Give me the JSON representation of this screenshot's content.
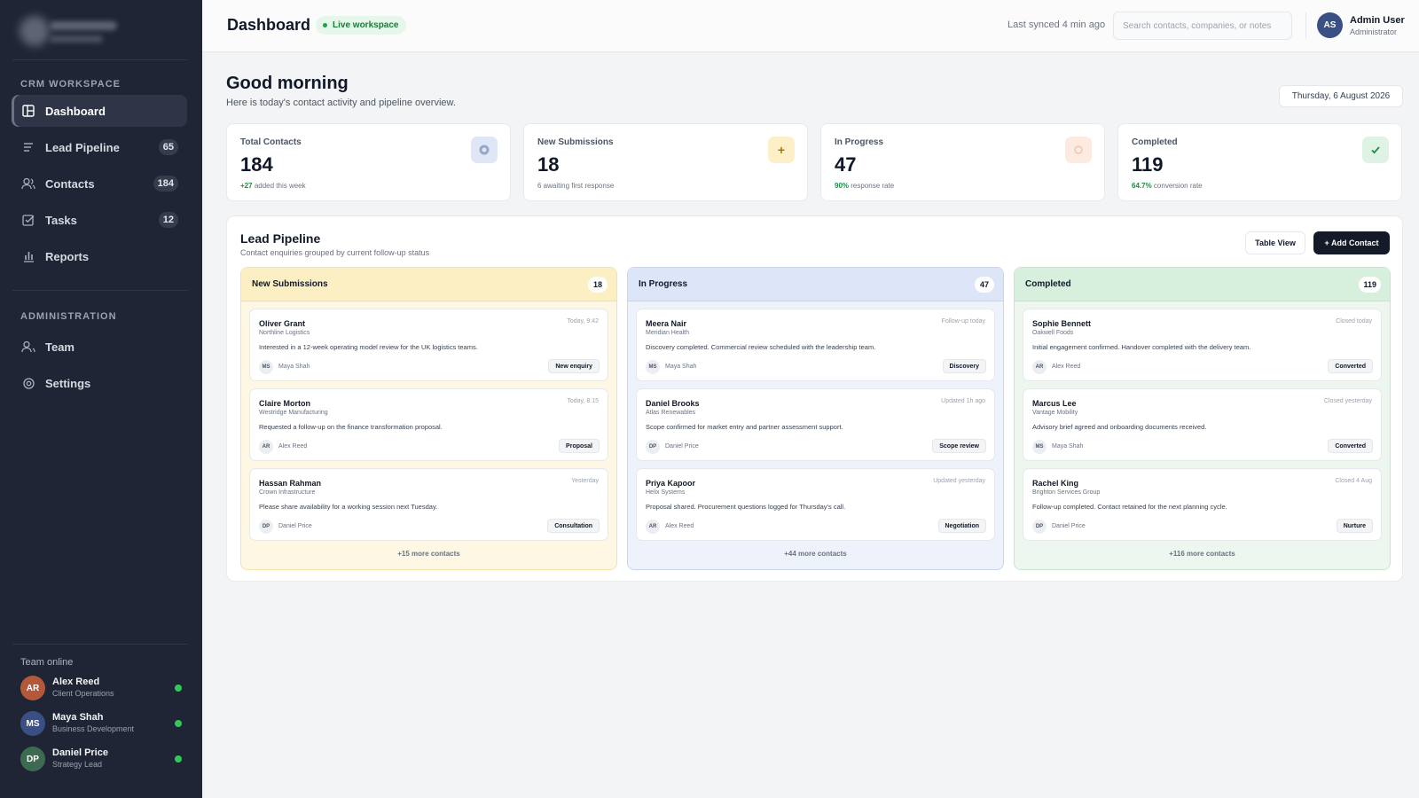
{
  "sidebar": {
    "sections": {
      "workspace": "CRM WORKSPACE",
      "admin": "ADMINISTRATION"
    },
    "nav": [
      {
        "label": "Dashboard",
        "icon": "dashboard-icon",
        "active": true
      },
      {
        "label": "Lead Pipeline",
        "icon": "pipeline-icon",
        "badge": "65"
      },
      {
        "label": "Contacts",
        "icon": "contacts-icon",
        "badge": "184"
      },
      {
        "label": "Tasks",
        "icon": "tasks-icon",
        "badge": "12"
      },
      {
        "label": "Reports",
        "icon": "reports-icon"
      }
    ],
    "admin_nav": [
      {
        "label": "Team",
        "icon": "team-icon"
      },
      {
        "label": "Settings",
        "icon": "settings-icon"
      }
    ],
    "team_title": "Team online",
    "team": [
      {
        "initials": "AR",
        "name": "Alex Reed",
        "role": "Client Operations",
        "color": "#b4583a"
      },
      {
        "initials": "MS",
        "name": "Maya Shah",
        "role": "Business Development",
        "color": "#3a4f84"
      },
      {
        "initials": "DP",
        "name": "Daniel Price",
        "role": "Strategy Lead",
        "color": "#3d6b52"
      }
    ]
  },
  "header": {
    "title": "Dashboard",
    "live_badge": "Live workspace",
    "sync": "Last synced 4 min ago",
    "search_placeholder": "Search contacts, companies, or notes",
    "user": {
      "initials": "AS",
      "name": "Admin User",
      "role": "Administrator"
    }
  },
  "greeting": {
    "title": "Good morning",
    "subtitle": "Here is today's contact activity and pipeline overview.",
    "date": "Thursday, 6 August 2026"
  },
  "stats": [
    {
      "label": "Total Contacts",
      "value": "184",
      "highlight": "+27",
      "note": "added this week",
      "icon": "contacts-stat-icon",
      "color": "#dfe6f5"
    },
    {
      "label": "New Submissions",
      "value": "18",
      "highlight": "",
      "note": "6 awaiting first response",
      "icon": "plus-icon",
      "color": "#fdf0c9"
    },
    {
      "label": "In Progress",
      "value": "47",
      "highlight": "90%",
      "note": "response rate",
      "icon": "progress-icon",
      "color": "#fdebe2"
    },
    {
      "label": "Completed",
      "value": "119",
      "highlight": "64.7%",
      "note": "conversion rate",
      "icon": "check-icon",
      "color": "#dff3e4"
    }
  ],
  "pipeline": {
    "title": "Lead Pipeline",
    "subtitle": "Contact enquiries grouped by current follow-up status",
    "table_view": "Table View",
    "add_contact": "+ Add Contact",
    "columns": [
      {
        "title": "New Submissions",
        "count": "18",
        "more": "+15 more contacts",
        "cards": [
          {
            "name": "Oliver Grant",
            "company": "Northline Logistics",
            "time": "Today, 9:42",
            "desc": "Interested in a 12-week operating model review for the UK logistics teams.",
            "owner_initials": "MS",
            "owner": "Maya Shah",
            "tag": "New enquiry"
          },
          {
            "name": "Claire Morton",
            "company": "Westridge Manufacturing",
            "time": "Today, 8:15",
            "desc": "Requested a follow-up on the finance transformation proposal.",
            "owner_initials": "AR",
            "owner": "Alex Reed",
            "tag": "Proposal"
          },
          {
            "name": "Hassan Rahman",
            "company": "Crown Infrastructure",
            "time": "Yesterday",
            "desc": "Please share availability for a working session next Tuesday.",
            "owner_initials": "DP",
            "owner": "Daniel Price",
            "tag": "Consultation"
          }
        ]
      },
      {
        "title": "In Progress",
        "count": "47",
        "more": "+44 more contacts",
        "cards": [
          {
            "name": "Meera Nair",
            "company": "Meridian Health",
            "time": "Follow-up today",
            "desc": "Discovery completed. Commercial review scheduled with the leadership team.",
            "owner_initials": "MS",
            "owner": "Maya Shah",
            "tag": "Discovery"
          },
          {
            "name": "Daniel Brooks",
            "company": "Atlas Renewables",
            "time": "Updated 1h ago",
            "desc": "Scope confirmed for market entry and partner assessment support.",
            "owner_initials": "DP",
            "owner": "Daniel Price",
            "tag": "Scope review"
          },
          {
            "name": "Priya Kapoor",
            "company": "Helix Systems",
            "time": "Updated yesterday",
            "desc": "Proposal shared. Procurement questions logged for Thursday's call.",
            "owner_initials": "AR",
            "owner": "Alex Reed",
            "tag": "Negotiation"
          }
        ]
      },
      {
        "title": "Completed",
        "count": "119",
        "more": "+116 more contacts",
        "cards": [
          {
            "name": "Sophie Bennett",
            "company": "Oakwell Foods",
            "time": "Closed today",
            "desc": "Initial engagement confirmed. Handover completed with the delivery team.",
            "owner_initials": "AR",
            "owner": "Alex Reed",
            "tag": "Converted"
          },
          {
            "name": "Marcus Lee",
            "company": "Vantage Mobility",
            "time": "Closed yesterday",
            "desc": "Advisory brief agreed and onboarding documents received.",
            "owner_initials": "MS",
            "owner": "Maya Shah",
            "tag": "Converted"
          },
          {
            "name": "Rachel King",
            "company": "Brighton Services Group",
            "time": "Closed 4 Aug",
            "desc": "Follow-up completed. Contact retained for the next planning cycle.",
            "owner_initials": "DP",
            "owner": "Daniel Price",
            "tag": "Nurture"
          }
        ]
      }
    ]
  }
}
